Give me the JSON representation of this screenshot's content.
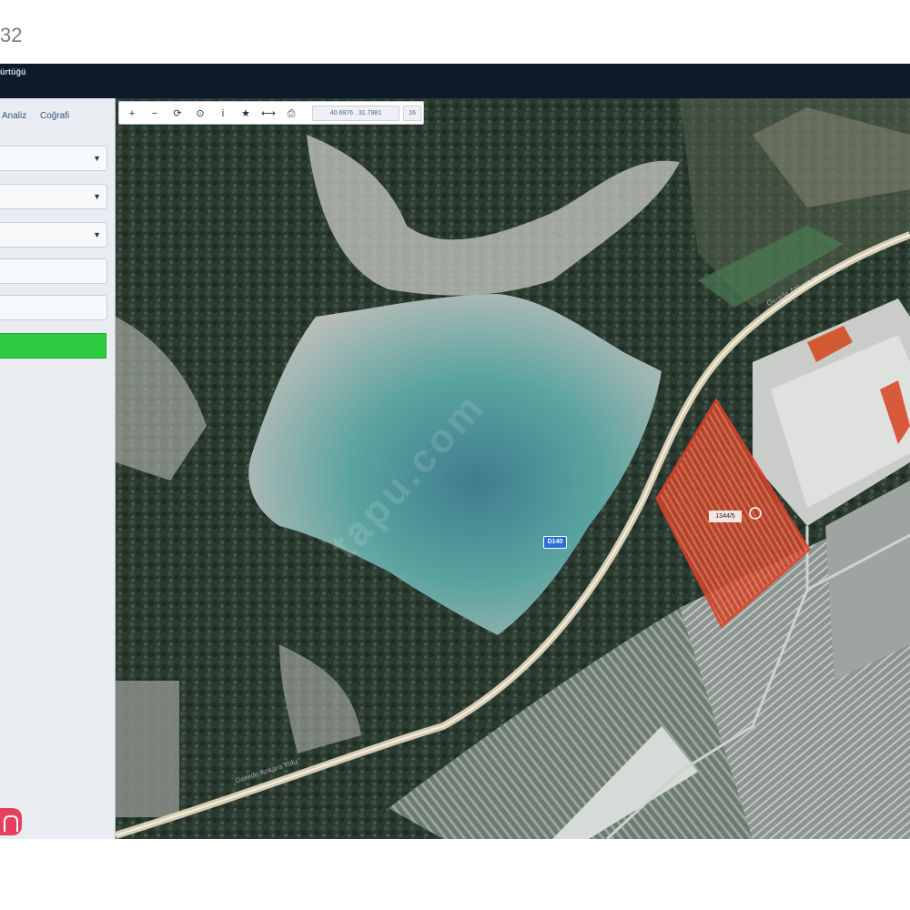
{
  "frame": {
    "counter": "32"
  },
  "titlebar": {
    "title": "ürtüğü"
  },
  "sidebar": {
    "tabs": [
      "Analiz",
      "Coğrafi"
    ],
    "dropdowns": [
      {
        "value": "",
        "caret": "▼"
      },
      {
        "value": "",
        "caret": "▼"
      },
      {
        "value": "",
        "caret": "▼"
      }
    ],
    "inputs": [
      {
        "value": ""
      },
      {
        "value": ""
      }
    ],
    "action_button_color": "#2ecc40"
  },
  "toolbar": {
    "tools": [
      {
        "icon": "zoom-in-icon",
        "glyph": "+"
      },
      {
        "icon": "zoom-out-icon",
        "glyph": "−"
      },
      {
        "icon": "refresh-icon",
        "glyph": "⟳"
      },
      {
        "icon": "target-icon",
        "glyph": "⊙"
      },
      {
        "icon": "info-icon",
        "glyph": "i"
      },
      {
        "icon": "star-icon",
        "glyph": "★"
      },
      {
        "icon": "measure-icon",
        "glyph": "⟷"
      },
      {
        "icon": "print-icon",
        "glyph": "⎙"
      }
    ],
    "coordinates": "40.6976 . 31.7981",
    "zoom_level": "16"
  },
  "map": {
    "road_shield": "D140",
    "parcel_label": "1344/5",
    "parcel_color": "#e0412c",
    "watermark": "tapu.com",
    "road_labels": [
      "Gerede Ankara Yolu",
      "Gerede Ankara Yolu"
    ]
  }
}
